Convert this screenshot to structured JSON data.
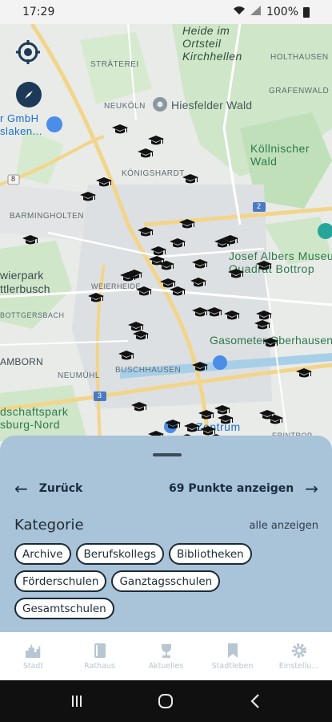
{
  "status_bar": {
    "time": "17:29",
    "battery": "100%"
  },
  "map": {
    "labels": {
      "heide": "Heide im\nOrtsteil\nKirchhellen",
      "holthausen": "HOLTHAUSEN",
      "straeterei": "STRÄTEREI",
      "grafenwald": "GRAFENWALD",
      "neukoln": "NEUKÖLN",
      "hiesfelder": "Hiesfelder Wald",
      "gmbh": "r GmbH\nslaken...",
      "koellnischer": "Köllnischer\nWald",
      "koenigshardt": "KÖNIGSHARDT",
      "barmingholten": "BARMINGHOLTEN",
      "josef": "Josef Albers Museum\nQuadrat Bottrop",
      "wierpark": "wierpark\nttlerbusch",
      "weierheide": "WEIERHEIDE",
      "bottgersbach": "BOTTGERSBACH",
      "gasometer": "Gasometer Oberhausen",
      "amborn": "AMBORN",
      "neumuhl": "NEUMÜHL",
      "buschhausen": "BUSCHHAUSEN",
      "dschaftspark": "dschaftspark\nsburg-Nord",
      "zentrum": "Zentrum",
      "eisenbahn": "ERINTROP",
      "road2": "2",
      "road3": "3",
      "road8": "8"
    }
  },
  "sheet": {
    "back_label": "Zurück",
    "show_label": "69 Punkte anzeigen",
    "category_title": "Kategorie",
    "show_all": "alle anzeigen",
    "chips": [
      [
        "Archive",
        "Berufskollegs",
        "Bibliotheken"
      ],
      [
        "Förderschulen",
        "Ganztagsschulen"
      ],
      [
        "Gesamtschulen"
      ]
    ]
  },
  "bottom_nav": [
    {
      "label": "Stadt",
      "icon": "city-icon"
    },
    {
      "label": "Rathaus",
      "icon": "book-icon"
    },
    {
      "label": "Aktuelles",
      "icon": "trophy-icon"
    },
    {
      "label": "Stadtleben",
      "icon": "bookmark-icon"
    },
    {
      "label": "Einstellu...",
      "icon": "gear-icon"
    }
  ],
  "colors": {
    "sheet_bg": "#a9c3d8",
    "nav_label": "#b8c6d2",
    "accent": "#1a2d3f"
  }
}
